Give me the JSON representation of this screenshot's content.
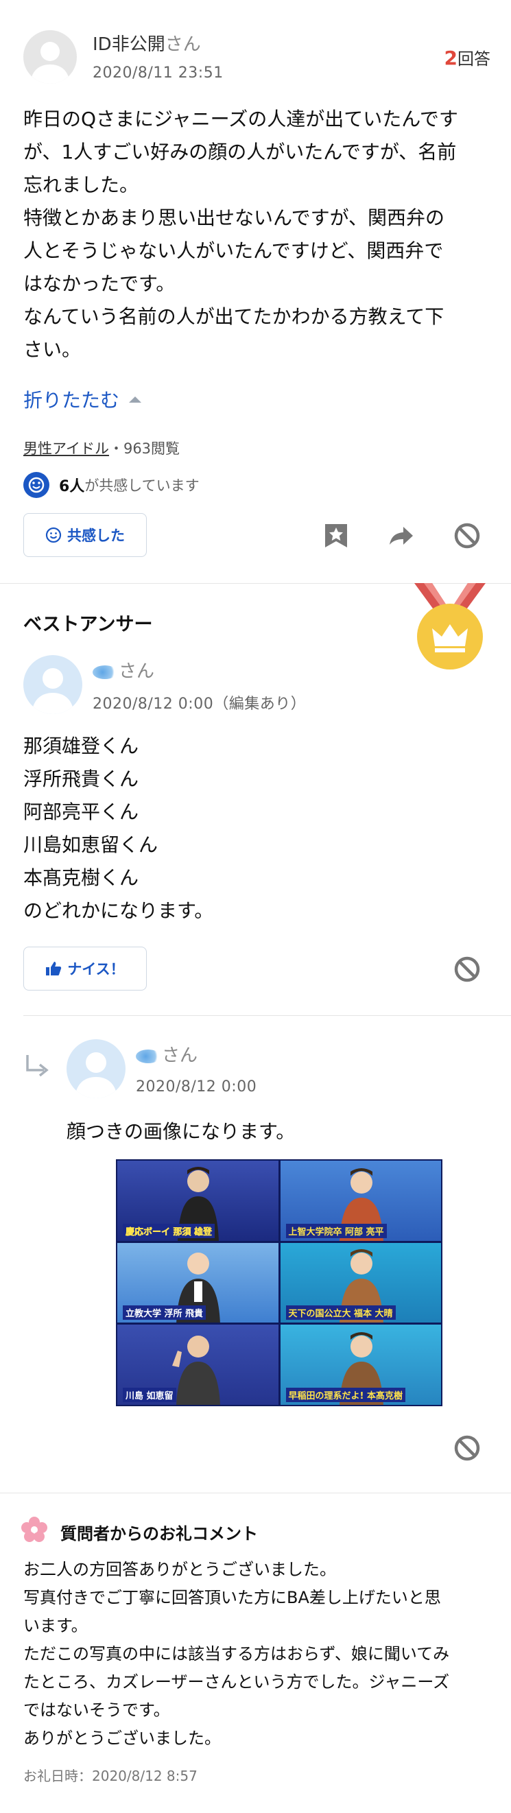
{
  "question": {
    "user_name": "ID非公開",
    "user_suffix": "さん",
    "date": "2020/8/11 23:51",
    "answer_count": "2",
    "answer_label": "回答",
    "body_lines": [
      "昨日のQさまにジャニーズの人達が出ていたんです",
      "が、1人すごい好みの顔の人がいたんですが、名前",
      "忘れました。",
      "特徴とかあまり思い出せないんですが、関西弁の",
      "人とそうじゃない人がいたんですけど、関西弁で",
      "はなかったです。",
      "なんていう名前の人が出てたかわかる方教えて下",
      "さい。"
    ],
    "collapse_label": "折りたたむ",
    "category": "男性アイドル",
    "views": "・963閲覧",
    "empathy_count": "6人",
    "empathy_suffix": "が共感しています",
    "empathy_button": "共感した"
  },
  "best_answer": {
    "heading": "ベストアンサー",
    "user_suffix": "さん",
    "date": "2020/8/12 0:00（編集あり）",
    "body_lines": [
      "那須雄登くん",
      "浮所飛貴くん",
      "阿部亮平くん",
      "川島如恵留くん",
      "本髙克樹くん",
      "のどれかになります。"
    ],
    "nice_button": "ナイス！"
  },
  "reply": {
    "user_suffix": "さん",
    "date": "2020/8/12 0:00",
    "body": "顔つきの画像になります。",
    "captions": [
      "慶応ボーイ 那須 雄登",
      "上智大学院卒 阿部 亮平",
      "立教大学 浮所 飛貴",
      "天下の国公立大 福本 大晴",
      "川島 如恵留",
      "早稲田の理系だよ! 本髙克樹"
    ]
  },
  "thanks": {
    "heading": "質問者からのお礼コメント",
    "body_lines": [
      "お二人の方回答ありがとうございました。",
      "写真付きでご丁寧に回答頂いた方にBA差し上げたいと思",
      "います。",
      "ただこの写真の中には該当する方はおらず、娘に聞いてみ",
      "たところ、カズレーザーさんという方でした。ジャニーズ",
      "ではないそうです。",
      "ありがとうございました。"
    ],
    "date": "お礼日時：2020/8/12 8:57"
  },
  "colors": {
    "accent_blue": "#1b57c4",
    "answer_count_red": "#e0483b",
    "medal_gold": "#f5c842",
    "ribbon_red": "#d9534f"
  },
  "icons": [
    "bookmark-star-icon",
    "share-arrow-icon",
    "block-icon",
    "thumbs-up-icon",
    "smile-icon",
    "reply-arrow-icon",
    "crown-medal-icon",
    "flower-icon"
  ]
}
